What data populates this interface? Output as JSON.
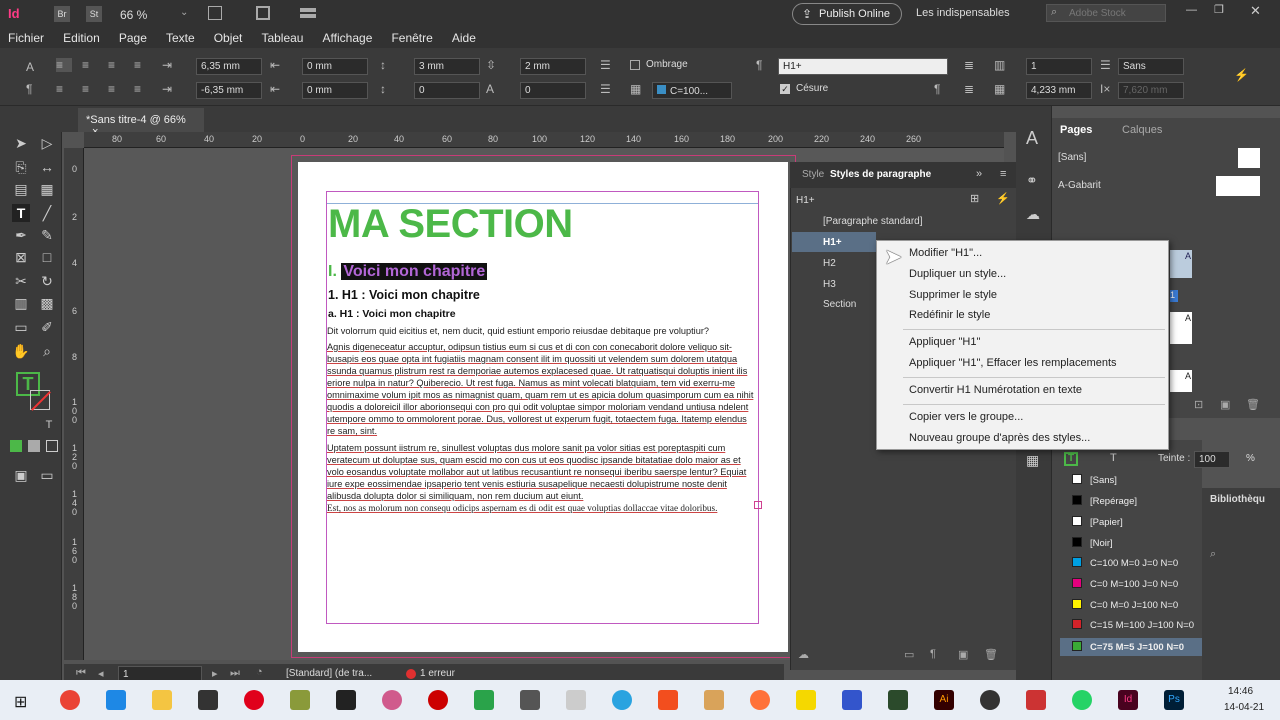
{
  "titlebar": {
    "app_icon": "Id",
    "icons": [
      "Br",
      "St"
    ],
    "zoom": "66 %",
    "publish_online": "Publish Online",
    "workspace": "Les indispensables",
    "search_placeholder": "Adobe Stock"
  },
  "menu": [
    "Fichier",
    "Edition",
    "Page",
    "Texte",
    "Objet",
    "Tableau",
    "Affichage",
    "Fenêtre",
    "Aide"
  ],
  "control": {
    "indent_left": "6,35 mm",
    "indent_first": "-6,35 mm",
    "indent_right": "0 mm",
    "indent_last": "0 mm",
    "space_before": "3 mm",
    "space_after": "0",
    "space_between": "2 mm",
    "space_between2": "0",
    "shading_label": "Ombrage",
    "shading_color": "C=100...",
    "paragraph_style": "H1+",
    "hyphenation_label": "Césure",
    "columns": "1",
    "gutter": "4,233 mm",
    "char_style": "Sans",
    "span_value": "7,620 mm"
  },
  "document_tab": "*Sans titre-4 @ 66%",
  "ruler_h": [
    "80",
    "60",
    "40",
    "20",
    "0",
    "20",
    "40",
    "60",
    "80",
    "100",
    "120",
    "140",
    "160",
    "180",
    "200",
    "220",
    "240",
    "260"
  ],
  "ruler_v": [
    "0",
    "2",
    "4",
    "6",
    "8",
    "1 0 0",
    "1 2 0",
    "1 4 0",
    "1 6 0",
    "1 8 0"
  ],
  "doc": {
    "title": "MA SECTION",
    "chapter_num": "I.",
    "chapter": "Voici mon chapitre",
    "h1": "1.  H1 : Voici mon chapitre",
    "h1a": "a.  H1 : Voici mon chapitre",
    "p1": "Dit volorrum quid eicitius et, nem ducit, quid estiunt emporio reiusdae debitaque pre voluptiur?",
    "p2": "Agnis digeneceatur accuptur, odipsun tistius eum si cus et di con con conecaborit dolore veliquo sit-busapis eos quae opta int fugiatiis magnam consent ilit im quossiti ut velendem sum dolorem utatqua ssunda quamus plistrum rest ra demporiae autemos explacesed quae. Ut ratquatisqui doluptis inient ilis eriore nulpa in natur? Quiberecio. Ut rest fuga. Namus as mint volecati blatquiam, tem vid exerru-me omnimaxime volum ipit mos as nimagnist quam, quam rem ut es apicia dolum quasimporum cum ea nihit quodis a doloreicil illor aborionsequi con pro qui odit voluptae simpor moloriam vendand untiusa ndelent utempore ommo to ommolorent porae. Dus, vollorest ut experum fugit, totaectem fuga. Itatemp elendus re sam, sint.",
    "p3": "Uptatem possunt iistrum re, sinullest voluptas dus molore sanit pa volor sitias est poreptaspiti cum veratecum ut doluptae sus, quam escid mo con cus ut eos quodisc ipsande bitatatiae dolo maior as et volo eosandus voluptate mollabor aut ut latibus recusantiunt re nonsequi iberibu saerspe lentur? Equiat iure expe eossimendae ipsaperio tent venis estiuria susapelique necaesti dolupistrume noste denit alibusda dolupta dolor si similiquam, non rem ducium aut eiunt.",
    "p4": "Est, nos as molorum non consequ odicips aspernam es di odit est quae voluptias dollaccae vitae doloribus."
  },
  "status": {
    "page": "1",
    "style": "[Standard] (de tra...",
    "errors": "1 erreur"
  },
  "styles_panel": {
    "tab_inactive": "Style",
    "tab_active": "Styles de paragraphe",
    "current": "H1+",
    "items": [
      "[Paragraphe standard]",
      "H1+",
      "H2",
      "H3",
      "Section"
    ]
  },
  "context_menu": {
    "items": [
      "Modifier \"H1\"...",
      "Dupliquer un style...",
      "Supprimer le style",
      "Redéfinir le style",
      "Appliquer \"H1\"",
      "Appliquer \"H1\", Effacer les remplacements",
      "Convertir H1 Numérotation en texte",
      "Copier vers le groupe...",
      "Nouveau groupe d'après des styles..."
    ]
  },
  "pages_panel": {
    "tab_active": "Pages",
    "tab_inactive": "Calques",
    "none": "[Sans]",
    "master": "A-Gabarit",
    "page_label": "1",
    "master_letter": "A"
  },
  "swatches": {
    "tint_label": "Teinte :",
    "tint_value": "100",
    "tint_unit": "%",
    "items": [
      {
        "name": "[Sans]",
        "color": "#ffffff"
      },
      {
        "name": "[Repérage]",
        "color": "#000000"
      },
      {
        "name": "[Papier]",
        "color": "#ffffff"
      },
      {
        "name": "[Noir]",
        "color": "#000000"
      },
      {
        "name": "C=100 M=0 J=0 N=0",
        "color": "#00a0e3"
      },
      {
        "name": "C=0 M=100 J=0 N=0",
        "color": "#e5007e"
      },
      {
        "name": "C=0 M=0 J=100 N=0",
        "color": "#fff200"
      },
      {
        "name": "C=15 M=100 J=100 N=0",
        "color": "#d2232a"
      },
      {
        "name": "C=75 M=5 J=100 N=0",
        "color": "#3aaa35"
      }
    ]
  },
  "library": "Bibliothèqu",
  "clock": {
    "time": "14:46",
    "date": "14-04-21"
  },
  "colors": {
    "accent_green": "#4cb848",
    "chapter_purple": "#8e44ad",
    "margin_purple": "#c059c0"
  }
}
